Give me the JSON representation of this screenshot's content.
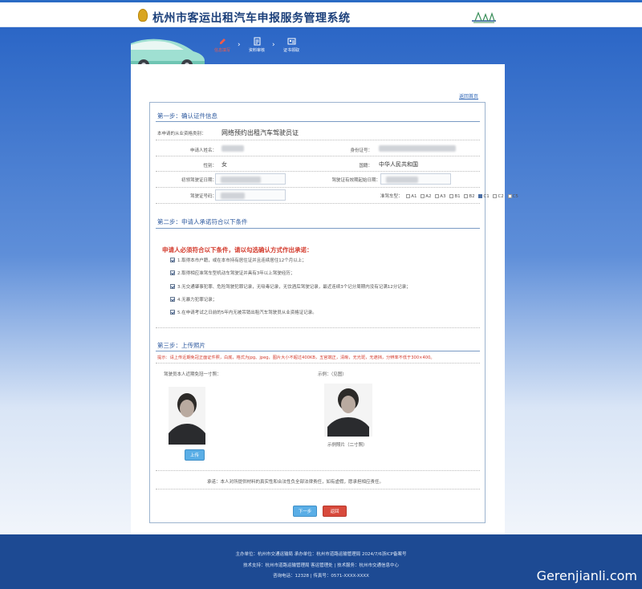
{
  "header": {
    "title": "杭州市客运出租汽车申报服务管理系统"
  },
  "steps": [
    {
      "label": "信息填写"
    },
    {
      "label": "资料审核"
    },
    {
      "label": "证书领取"
    }
  ],
  "panel": {
    "return_link": "返回首页"
  },
  "section1": {
    "title": "第一步：确认证件信息",
    "apply_type_label": "本申请的从业资格类别：",
    "apply_type_value": "网络预约出租汽车驾驶员证",
    "name_label": "申请人姓名：",
    "id_label": "身份证号：",
    "gender_label": "性别：",
    "gender_value": "女",
    "nationality_label": "国籍：",
    "nationality_value": "中华人民共和国",
    "driver_first_date_label": "初领驾驶证日期：",
    "driver_valid_label": "驾驶证有效期起始日期：",
    "driver_license_label": "驾驶证号码：",
    "driving_class_label": "准驾车型：",
    "driving_classes": [
      {
        "label": "A1",
        "checked": false
      },
      {
        "label": "A2",
        "checked": false
      },
      {
        "label": "A3",
        "checked": false
      },
      {
        "label": "B1",
        "checked": false
      },
      {
        "label": "B2",
        "checked": false
      },
      {
        "label": "C1",
        "checked": true
      },
      {
        "label": "C2",
        "checked": false
      },
      {
        "label": "C5",
        "checked": false
      }
    ]
  },
  "section2": {
    "title": "第二步：申请人承诺符合以下条件",
    "warning": "申请人必须符合以下条件，请以勾选确认方式作出承诺：",
    "conditions": [
      "1.取得本市户籍，或在本市持有居住证并且连续居住12个月以上；",
      "2.取得相应准驾车型机动车驾驶证并具有3年以上驾驶经历；",
      "3.无交通肇事犯罪、危险驾驶犯罪记录，无吸毒记录，无饮酒后驾驶记录，最近连续3个记分周期内没有记满12分记录；",
      "4.无暴力犯罪记录；",
      "5.在申请考试之日前的5年内无被吊销出租汽车驾驶员从业资格证记录。"
    ]
  },
  "section3": {
    "title": "第三步：上传照片",
    "note": "提示：请上传近期免冠正面证件照，白底，格式为jpg、jpeg，图片大小不超过400KB，五官端正，清晰，无光斑，无遮挡，分辨率不低于300×400。",
    "photo_left_label": "驾驶员本人近期免冠一寸照：",
    "photo_right_label": "示例：（见图）",
    "photo_right_caption": "示例照片（二寸照）",
    "upload_label": "上传",
    "pledge": "承诺：本人对所提供材料的真实性和合法性负全部法律责任，如有虚假，愿承担相应责任。"
  },
  "actions": {
    "next_label": "下一步",
    "back_label": "返回"
  },
  "footer": {
    "line1": "主办单位：杭州市交通运输局  承办单位：杭州市道路运输管理局  2024/7/6浙ICP备案号",
    "line2": "技术支持：杭州市道路运输管理局  客运管理处  |  技术服务：杭州市交通信息中心",
    "line3": "咨询电话：12328  |  传真号：0571-XXXX-XXXX"
  },
  "watermark": "Gerenjianli.com",
  "colors": {
    "brand_blue": "#2b66c6",
    "footer_blue": "#1d4a93",
    "section_title": "#2e5a9f",
    "warning_red": "#d33a2c",
    "primary_button": "#5aaee6",
    "danger_button": "#d84a3c"
  }
}
